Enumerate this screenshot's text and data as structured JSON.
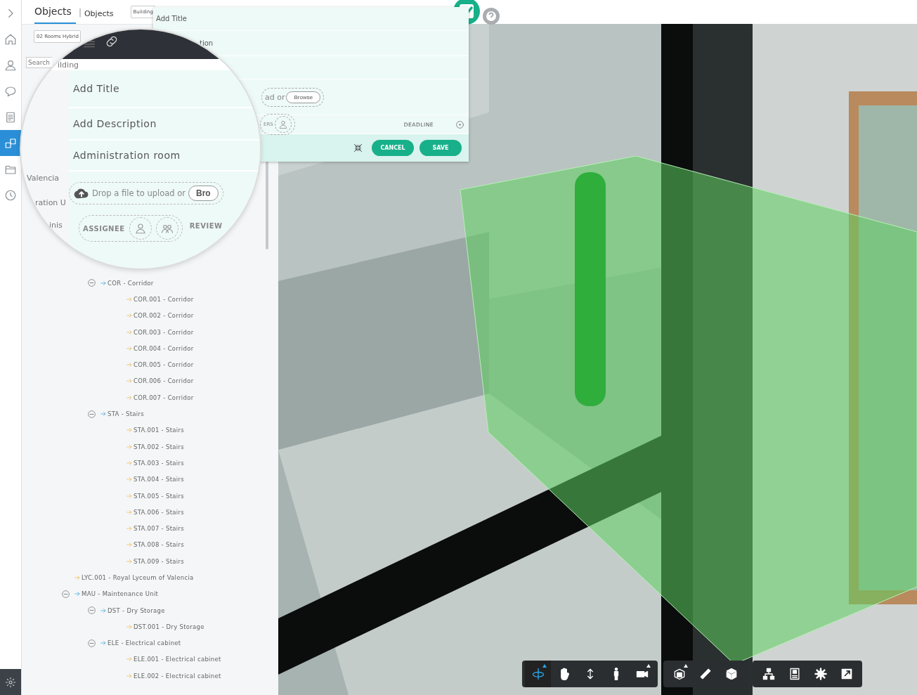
{
  "sidebar": {
    "items": [
      {
        "kind": "expand",
        "selected": false
      },
      {
        "kind": "home",
        "selected": false
      },
      {
        "kind": "user",
        "selected": false
      },
      {
        "kind": "chat",
        "selected": false
      },
      {
        "kind": "document",
        "selected": false
      },
      {
        "kind": "objects",
        "selected": true
      },
      {
        "kind": "folder",
        "selected": false
      },
      {
        "kind": "history",
        "selected": false
      }
    ],
    "bottom_item": {
      "kind": "settings"
    }
  },
  "panel": {
    "title": "Objects",
    "separator": "|",
    "subtitle": "Objects",
    "building_dropdown": "Building",
    "model_dropdown": "02 Rooms Hybrid",
    "search": {
      "placeholder": "Search"
    },
    "tree": {
      "continued_children": [
        {
          "label": "COR - Corridor",
          "expanded": true,
          "children": [
            {
              "label": "COR.001 - Corridor"
            },
            {
              "label": "COR.002 - Corridor"
            },
            {
              "label": "COR.003 - Corridor"
            },
            {
              "label": "COR.004 - Corridor"
            },
            {
              "label": "COR.005 - Corridor"
            },
            {
              "label": "COR.006 - Corridor"
            },
            {
              "label": "COR.007 - Corridor"
            }
          ]
        },
        {
          "label": "STA - Stairs",
          "expanded": true,
          "children": [
            {
              "label": "STA.001 - Stairs"
            },
            {
              "label": "STA.002 - Stairs"
            },
            {
              "label": "STA.003 - Stairs"
            },
            {
              "label": "STA.004 - Stairs"
            },
            {
              "label": "STA.005 - Stairs"
            },
            {
              "label": "STA.006 - Stairs"
            },
            {
              "label": "STA.007 - Stairs"
            },
            {
              "label": "STA.008 - Stairs"
            },
            {
              "label": "STA.009 - Stairs"
            }
          ]
        }
      ],
      "items": [
        {
          "label": "LYC.001 - Royal Lyceum of Valencia"
        },
        {
          "label": "MAU - Maintenance Unit",
          "expanded": true,
          "children": [
            {
              "label": "DST - Dry Storage",
              "expanded": true,
              "children": [
                {
                  "label": "DST.001 - Dry Storage"
                }
              ]
            },
            {
              "label": "ELE - Electrical cabinet",
              "expanded": true,
              "children": [
                {
                  "label": "ELE.001 - Electrical cabinet"
                },
                {
                  "label": "ELE.002 - Electrical cabinet"
                }
              ]
            }
          ]
        }
      ]
    }
  },
  "task_form": {
    "title_placeholder": "Add Title",
    "description_fragment": "tion",
    "drop_fragment": "ad or",
    "browse": "Browse",
    "people_fragment": "ERS",
    "deadline": "DEADLINE",
    "cancel": "CANCEL",
    "save": "SAVE"
  },
  "magnifier": {
    "side_fragments": [
      "ilding",
      "Valencia",
      "ration U",
      "inis"
    ],
    "title_placeholder": "Add Title",
    "description_placeholder": "Add Description",
    "location": "Administration room",
    "drop_text": "Drop a file to upload or",
    "browse_fragment": "Bro",
    "assignee": "ASSIGNEE",
    "reviewer_fragment": "REVIEW"
  },
  "toolbar": {
    "groups": [
      [
        {
          "kind": "orbit",
          "selected": true,
          "menu": true
        },
        {
          "kind": "pan",
          "selected": false,
          "menu": false
        },
        {
          "kind": "vertical",
          "selected": false,
          "menu": false
        },
        {
          "kind": "walk",
          "selected": false,
          "menu": false
        },
        {
          "kind": "camera",
          "selected": false,
          "menu": true
        }
      ],
      [
        {
          "kind": "section",
          "selected": false,
          "menu": true
        },
        {
          "kind": "measure",
          "selected": false,
          "menu": false
        },
        {
          "kind": "cube",
          "selected": false,
          "menu": false
        }
      ],
      [
        {
          "kind": "hierarchy",
          "selected": false,
          "menu": false
        },
        {
          "kind": "properties",
          "selected": false,
          "menu": false
        },
        {
          "kind": "settings",
          "selected": false,
          "menu": false
        },
        {
          "kind": "fullscreen",
          "selected": false,
          "menu": false
        }
      ]
    ]
  }
}
